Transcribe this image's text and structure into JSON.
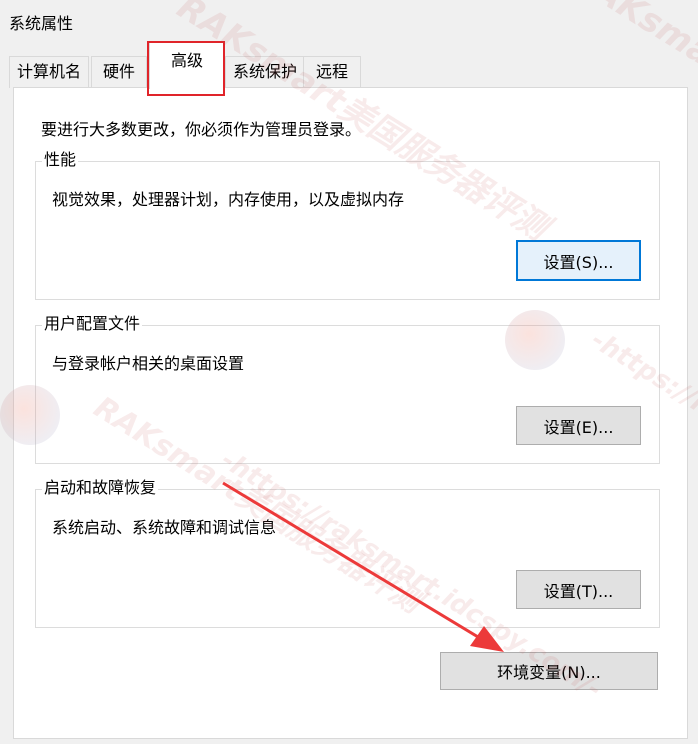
{
  "window": {
    "title": "系统属性"
  },
  "tabs": [
    {
      "label": "计算机名"
    },
    {
      "label": "硬件"
    },
    {
      "label": "高级"
    },
    {
      "label": "系统保护"
    },
    {
      "label": "远程"
    }
  ],
  "notice": "要进行大多数更改，你必须作为管理员登录。",
  "groups": {
    "performance": {
      "title": "性能",
      "description": "视觉效果，处理器计划，内存使用，以及虚拟内存",
      "button": "设置(S)..."
    },
    "profiles": {
      "title": "用户配置文件",
      "description": "与登录帐户相关的桌面设置",
      "button": "设置(E)..."
    },
    "startup": {
      "title": "启动和故障恢复",
      "description": "系统启动、系统故障和调试信息",
      "button": "设置(T)..."
    }
  },
  "env_button": "环境变量(N)...",
  "watermark": {
    "brand": "RAKsmart美国服务器评测",
    "url": "-https://raksmart.idcspy.com/-"
  },
  "colors": {
    "highlight": "#e0242a",
    "arrow": "#ec3a3a",
    "focus_border": "#0078d7"
  }
}
